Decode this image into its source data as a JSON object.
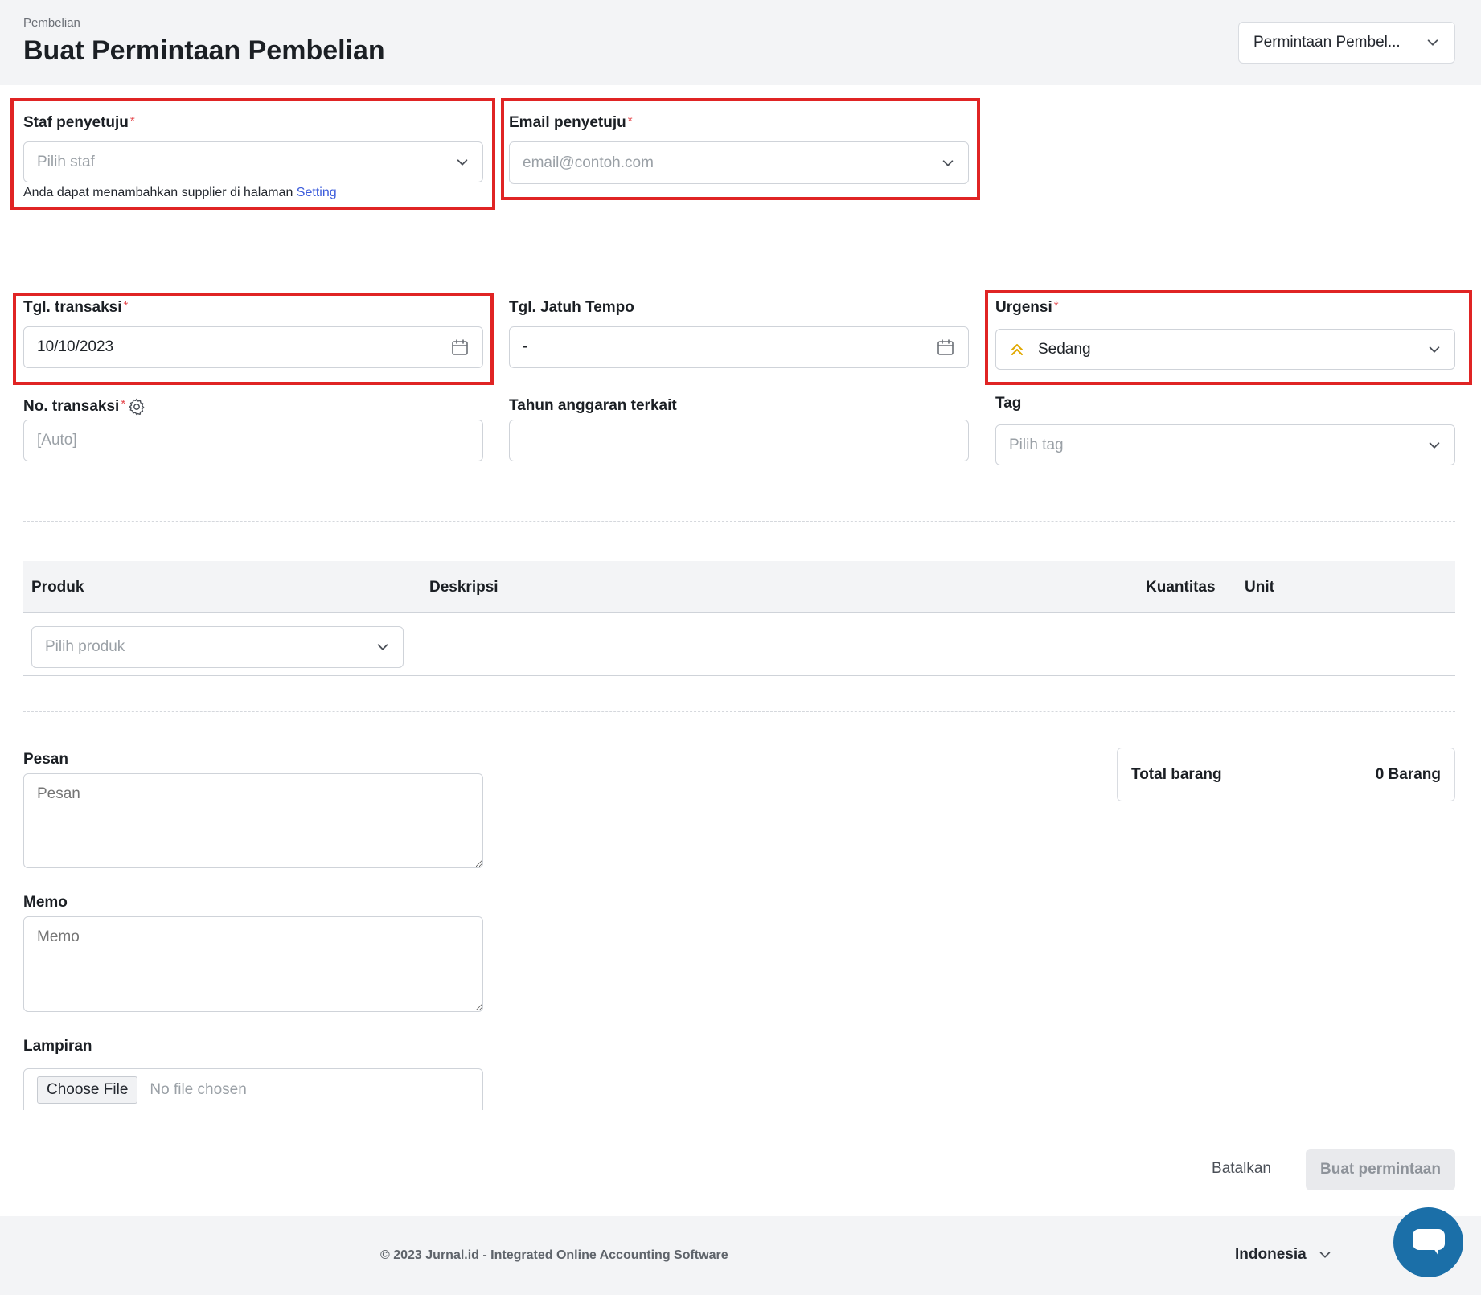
{
  "header": {
    "breadcrumb": "Pembelian",
    "title": "Buat Permintaan Pembelian",
    "type_select_value": "Permintaan Pembel..."
  },
  "approver": {
    "staff_label": "Staf penyetuju",
    "staff_placeholder": "Pilih staf",
    "hint_text": "Anda dapat menambahkan supplier di halaman",
    "hint_link": "Setting",
    "email_label": "Email penyetuju",
    "email_placeholder": "email@contoh.com"
  },
  "details": {
    "trans_date_label": "Tgl. transaksi",
    "trans_date_value": "10/10/2023",
    "due_date_label": "Tgl. Jatuh Tempo",
    "due_date_value": "-",
    "urgency_label": "Urgensi",
    "urgency_value": "Sedang",
    "trans_no_label": "No. transaksi",
    "trans_no_placeholder": "[Auto]",
    "budget_year_label": "Tahun anggaran terkait",
    "budget_year_value": "",
    "tag_label": "Tag",
    "tag_placeholder": "Pilih tag"
  },
  "table": {
    "columns": [
      "Produk",
      "Deskripsi",
      "Kuantitas",
      "Unit"
    ],
    "product_placeholder": "Pilih produk"
  },
  "notes": {
    "message_label": "Pesan",
    "message_placeholder": "Pesan",
    "memo_label": "Memo",
    "memo_placeholder": "Memo",
    "attachment_label": "Lampiran",
    "choose_file": "Choose File",
    "no_file": "No file chosen"
  },
  "summary": {
    "total_label": "Total barang",
    "total_value": "0 Barang"
  },
  "actions": {
    "cancel": "Batalkan",
    "create": "Buat permintaan"
  },
  "footer": {
    "copyright": "© 2023 Jurnal.id - Integrated Online Accounting Software",
    "language": "Indonesia"
  },
  "colors": {
    "highlight": "#e02424",
    "urgency_icon": "#e0a800",
    "chat_button": "#1b6fa8",
    "link": "#3b5bdb"
  }
}
